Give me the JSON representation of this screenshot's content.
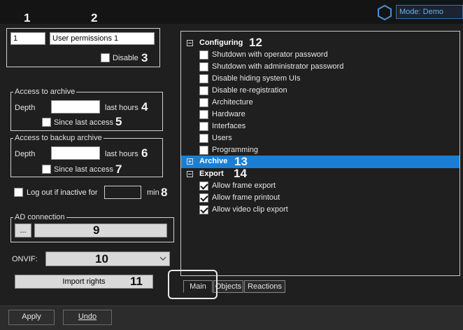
{
  "header": {
    "mode": "Mode: Demo",
    "hex_icon": "hexagon-icon"
  },
  "callouts": [
    "1",
    "2",
    "3",
    "4",
    "5",
    "6",
    "7",
    "8",
    "9",
    "10",
    "11",
    "12",
    "13",
    "14"
  ],
  "group": {
    "id": "1",
    "name": "User permissions 1",
    "disable_label": "Disable"
  },
  "archive_access": {
    "legend": "Access to archive",
    "depth_label": "Depth",
    "unit_label": "last hours",
    "since_label": "Since last access"
  },
  "backup_access": {
    "legend": "Access to backup archive",
    "depth_label": "Depth",
    "unit_label": "last hours",
    "since_label": "Since last access"
  },
  "logout": {
    "label": "Log out if inactive for",
    "unit": "min"
  },
  "ad": {
    "legend": "AD connection",
    "browse_label": "..."
  },
  "onvif": {
    "label": "ONVIF:"
  },
  "import_label": "Import rights",
  "tree": {
    "configuring": {
      "label": "Configuring",
      "items": [
        "Shutdown with operator password",
        "Shutdown with administrator password",
        "Disable hiding system UIs",
        "Disable re-registration",
        "Architecture",
        "Hardware",
        "Interfaces",
        "Users",
        "Programming"
      ]
    },
    "archive": {
      "label": "Archive"
    },
    "export": {
      "label": "Export",
      "items": [
        "Allow frame export",
        "Allow frame printout",
        "Allow video clip export"
      ]
    }
  },
  "tabs": [
    "Main",
    "Objects",
    "Reactions"
  ],
  "footer": {
    "apply": "Apply",
    "undo": "Undo"
  },
  "colors": {
    "selection": "#1a7fd4",
    "accent": "#3c6fa5"
  }
}
